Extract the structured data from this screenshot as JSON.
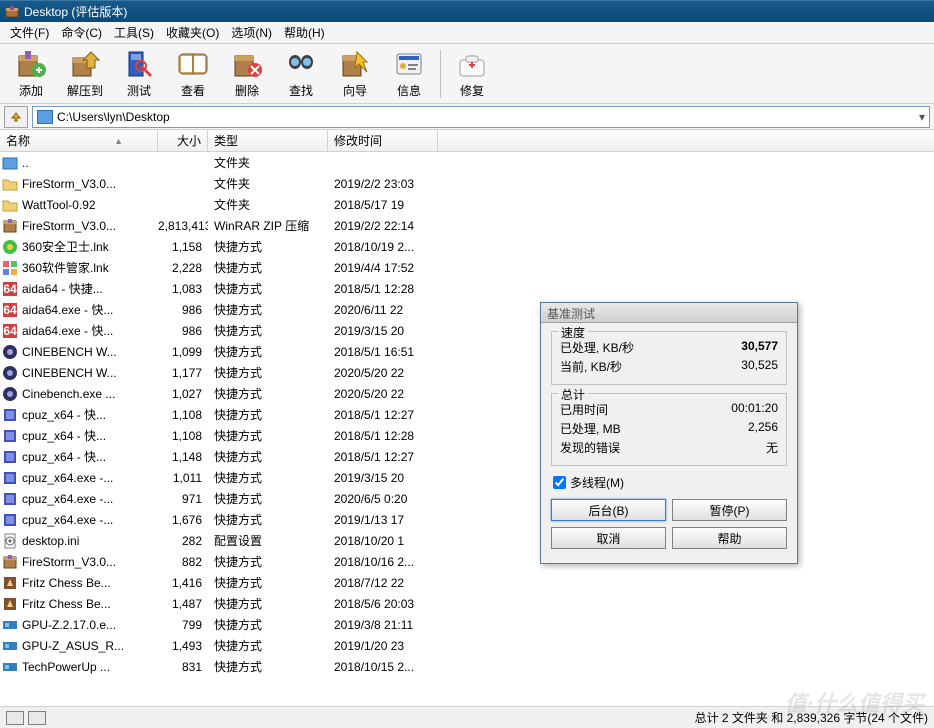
{
  "window": {
    "title": "Desktop (评估版本)"
  },
  "menu": [
    "文件(F)",
    "命令(C)",
    "工具(S)",
    "收藏夹(O)",
    "选项(N)",
    "帮助(H)"
  ],
  "toolbar": [
    {
      "label": "添加",
      "icon": "add"
    },
    {
      "label": "解压到",
      "icon": "extract"
    },
    {
      "label": "测试",
      "icon": "test"
    },
    {
      "label": "查看",
      "icon": "view"
    },
    {
      "label": "删除",
      "icon": "delete"
    },
    {
      "label": "查找",
      "icon": "find"
    },
    {
      "label": "向导",
      "icon": "wizard"
    },
    {
      "label": "信息",
      "icon": "info"
    },
    {
      "label": "修复",
      "icon": "repair"
    }
  ],
  "address": "C:\\Users\\lyn\\Desktop",
  "columns": {
    "name": "名称",
    "size": "大小",
    "type": "类型",
    "time": "修改时间"
  },
  "files": [
    {
      "icon": "up",
      "name": "..",
      "size": "",
      "type": "文件夹",
      "time": ""
    },
    {
      "icon": "folder",
      "name": "FireStorm_V3.0...",
      "size": "",
      "type": "文件夹",
      "time": "2019/2/2 23:03"
    },
    {
      "icon": "folder",
      "name": "WattTool-0.92",
      "size": "",
      "type": "文件夹",
      "time": "2018/5/17 19"
    },
    {
      "icon": "zip",
      "name": "FireStorm_V3.0...",
      "size": "2,813,413",
      "type": "WinRAR ZIP 压缩",
      "time": "2019/2/2 22:14"
    },
    {
      "icon": "app1",
      "name": "360安全卫士.lnk",
      "size": "1,158",
      "type": "快捷方式",
      "time": "2018/10/19 2..."
    },
    {
      "icon": "app2",
      "name": "360软件管家.lnk",
      "size": "2,228",
      "type": "快捷方式",
      "time": "2019/4/4 17:52"
    },
    {
      "icon": "aida",
      "name": "aida64 - 快捷...",
      "size": "1,083",
      "type": "快捷方式",
      "time": "2018/5/1 12:28"
    },
    {
      "icon": "aida",
      "name": "aida64.exe - 快...",
      "size": "986",
      "type": "快捷方式",
      "time": "2020/6/11 22"
    },
    {
      "icon": "aida",
      "name": "aida64.exe - 快...",
      "size": "986",
      "type": "快捷方式",
      "time": "2019/3/15 20"
    },
    {
      "icon": "cine",
      "name": "CINEBENCH W...",
      "size": "1,099",
      "type": "快捷方式",
      "time": "2018/5/1 16:51"
    },
    {
      "icon": "cine",
      "name": "CINEBENCH W...",
      "size": "1,177",
      "type": "快捷方式",
      "time": "2020/5/20 22"
    },
    {
      "icon": "cine",
      "name": "Cinebench.exe ...",
      "size": "1,027",
      "type": "快捷方式",
      "time": "2020/5/20 22"
    },
    {
      "icon": "cpuz",
      "name": "cpuz_x64 - 快...",
      "size": "1,108",
      "type": "快捷方式",
      "time": "2018/5/1 12:27"
    },
    {
      "icon": "cpuz",
      "name": "cpuz_x64 - 快...",
      "size": "1,108",
      "type": "快捷方式",
      "time": "2018/5/1 12:28"
    },
    {
      "icon": "cpuz",
      "name": "cpuz_x64 - 快...",
      "size": "1,148",
      "type": "快捷方式",
      "time": "2018/5/1 12:27"
    },
    {
      "icon": "cpuz",
      "name": "cpuz_x64.exe -...",
      "size": "1,011",
      "type": "快捷方式",
      "time": "2019/3/15 20"
    },
    {
      "icon": "cpuz",
      "name": "cpuz_x64.exe -...",
      "size": "971",
      "type": "快捷方式",
      "time": "2020/6/5 0:20"
    },
    {
      "icon": "cpuz",
      "name": "cpuz_x64.exe -...",
      "size": "1,676",
      "type": "快捷方式",
      "time": "2019/1/13 17"
    },
    {
      "icon": "ini",
      "name": "desktop.ini",
      "size": "282",
      "type": "配置设置",
      "time": "2018/10/20 1"
    },
    {
      "icon": "zip",
      "name": "FireStorm_V3.0...",
      "size": "882",
      "type": "快捷方式",
      "time": "2018/10/16 2..."
    },
    {
      "icon": "fritz",
      "name": "Fritz Chess Be...",
      "size": "1,416",
      "type": "快捷方式",
      "time": "2018/7/12 22"
    },
    {
      "icon": "fritz",
      "name": "Fritz Chess Be...",
      "size": "1,487",
      "type": "快捷方式",
      "time": "2018/5/6 20:03"
    },
    {
      "icon": "gpuz",
      "name": "GPU-Z.2.17.0.e...",
      "size": "799",
      "type": "快捷方式",
      "time": "2019/3/8 21:11"
    },
    {
      "icon": "gpuz",
      "name": "GPU-Z_ASUS_R...",
      "size": "1,493",
      "type": "快捷方式",
      "time": "2019/1/20 23"
    },
    {
      "icon": "gpuz",
      "name": "TechPowerUp ...",
      "size": "831",
      "type": "快捷方式",
      "time": "2018/10/15 2..."
    }
  ],
  "status": "总计 2 文件夹 和 2,839,326 字节(24 个文件)",
  "dialog": {
    "title": "基准测试",
    "speed_label": "速度",
    "processed_kbs_label": "已处理, KB/秒",
    "processed_kbs": "30,577",
    "current_kbs_label": "当前, KB/秒",
    "current_kbs": "30,525",
    "total_label": "总计",
    "elapsed_label": "已用时间",
    "elapsed": "00:01:20",
    "processed_mb_label": "已处理, MB",
    "processed_mb": "2,256",
    "errors_label": "发现的错误",
    "errors": "无",
    "multithread": "多线程(M)",
    "btn_bg": "后台(B)",
    "btn_pause": "暂停(P)",
    "btn_cancel": "取消",
    "btn_help": "帮助"
  },
  "watermark": "值·什么值得买"
}
